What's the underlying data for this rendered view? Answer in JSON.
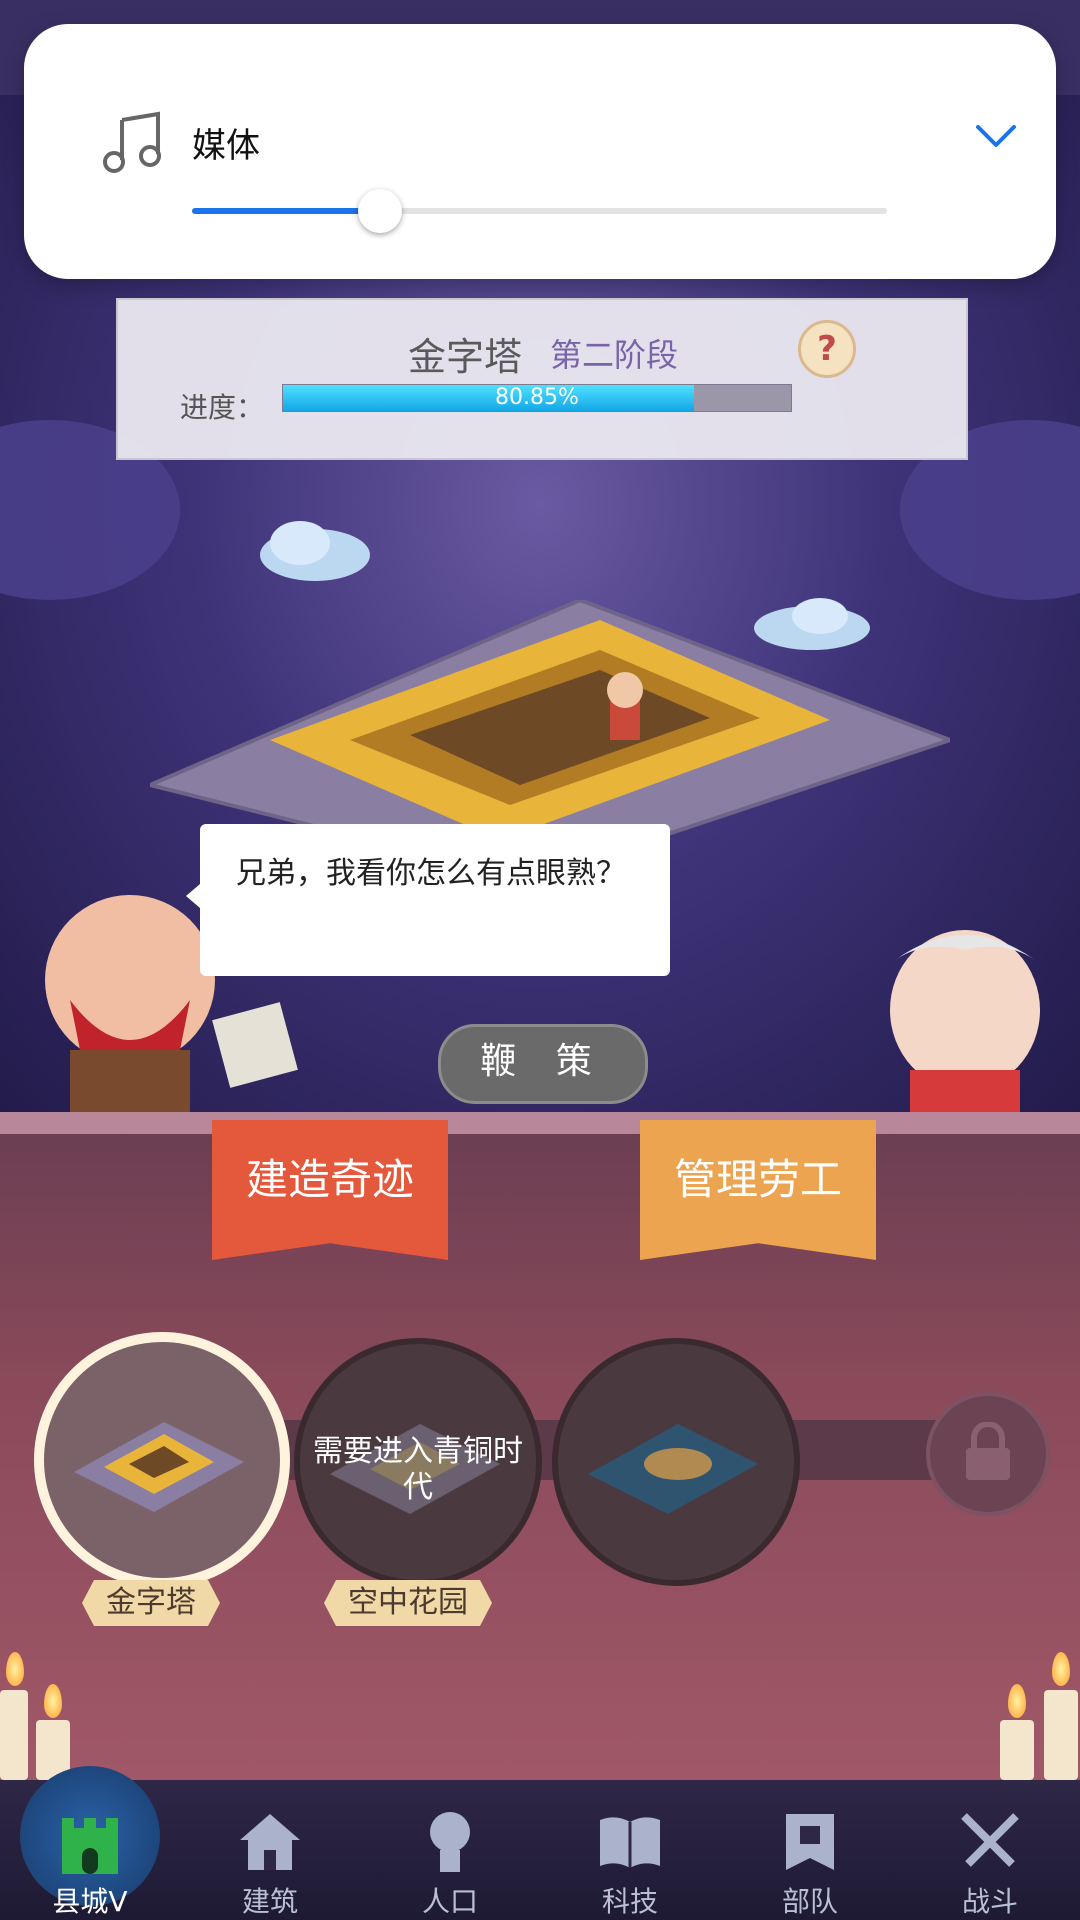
{
  "volume": {
    "label": "媒体",
    "level_percent": 27
  },
  "wonder_progress": {
    "title": "金字塔",
    "stage": "第二阶段",
    "progress_label": "进度：",
    "progress_percent": 80.85,
    "progress_text": "80.85%",
    "help_symbol": "?"
  },
  "speech": {
    "text": "兄弟，我看你怎么有点眼熟？"
  },
  "whip_button": {
    "label": "鞭 策"
  },
  "tabs": {
    "build_wonder": "建造奇迹",
    "manage_labor": "管理劳工"
  },
  "wonders": [
    {
      "label": "金字塔",
      "selected": true
    },
    {
      "label": "空中花园",
      "locked_text": "需要进入青铜时代"
    },
    {
      "label": ""
    }
  ],
  "bottom_nav": [
    {
      "label": "县城V",
      "icon": "castle-icon",
      "active": true
    },
    {
      "label": "建筑",
      "icon": "house-icon"
    },
    {
      "label": "人口",
      "icon": "person-icon"
    },
    {
      "label": "科技",
      "icon": "book-icon"
    },
    {
      "label": "部队",
      "icon": "banner-icon"
    },
    {
      "label": "战斗",
      "icon": "crossed-swords-icon"
    }
  ],
  "colors": {
    "accent_blue": "#1a73e8",
    "progress_cyan": "#12a7e6",
    "build_ribbon": "#e4583b",
    "manage_ribbon": "#eda450"
  }
}
